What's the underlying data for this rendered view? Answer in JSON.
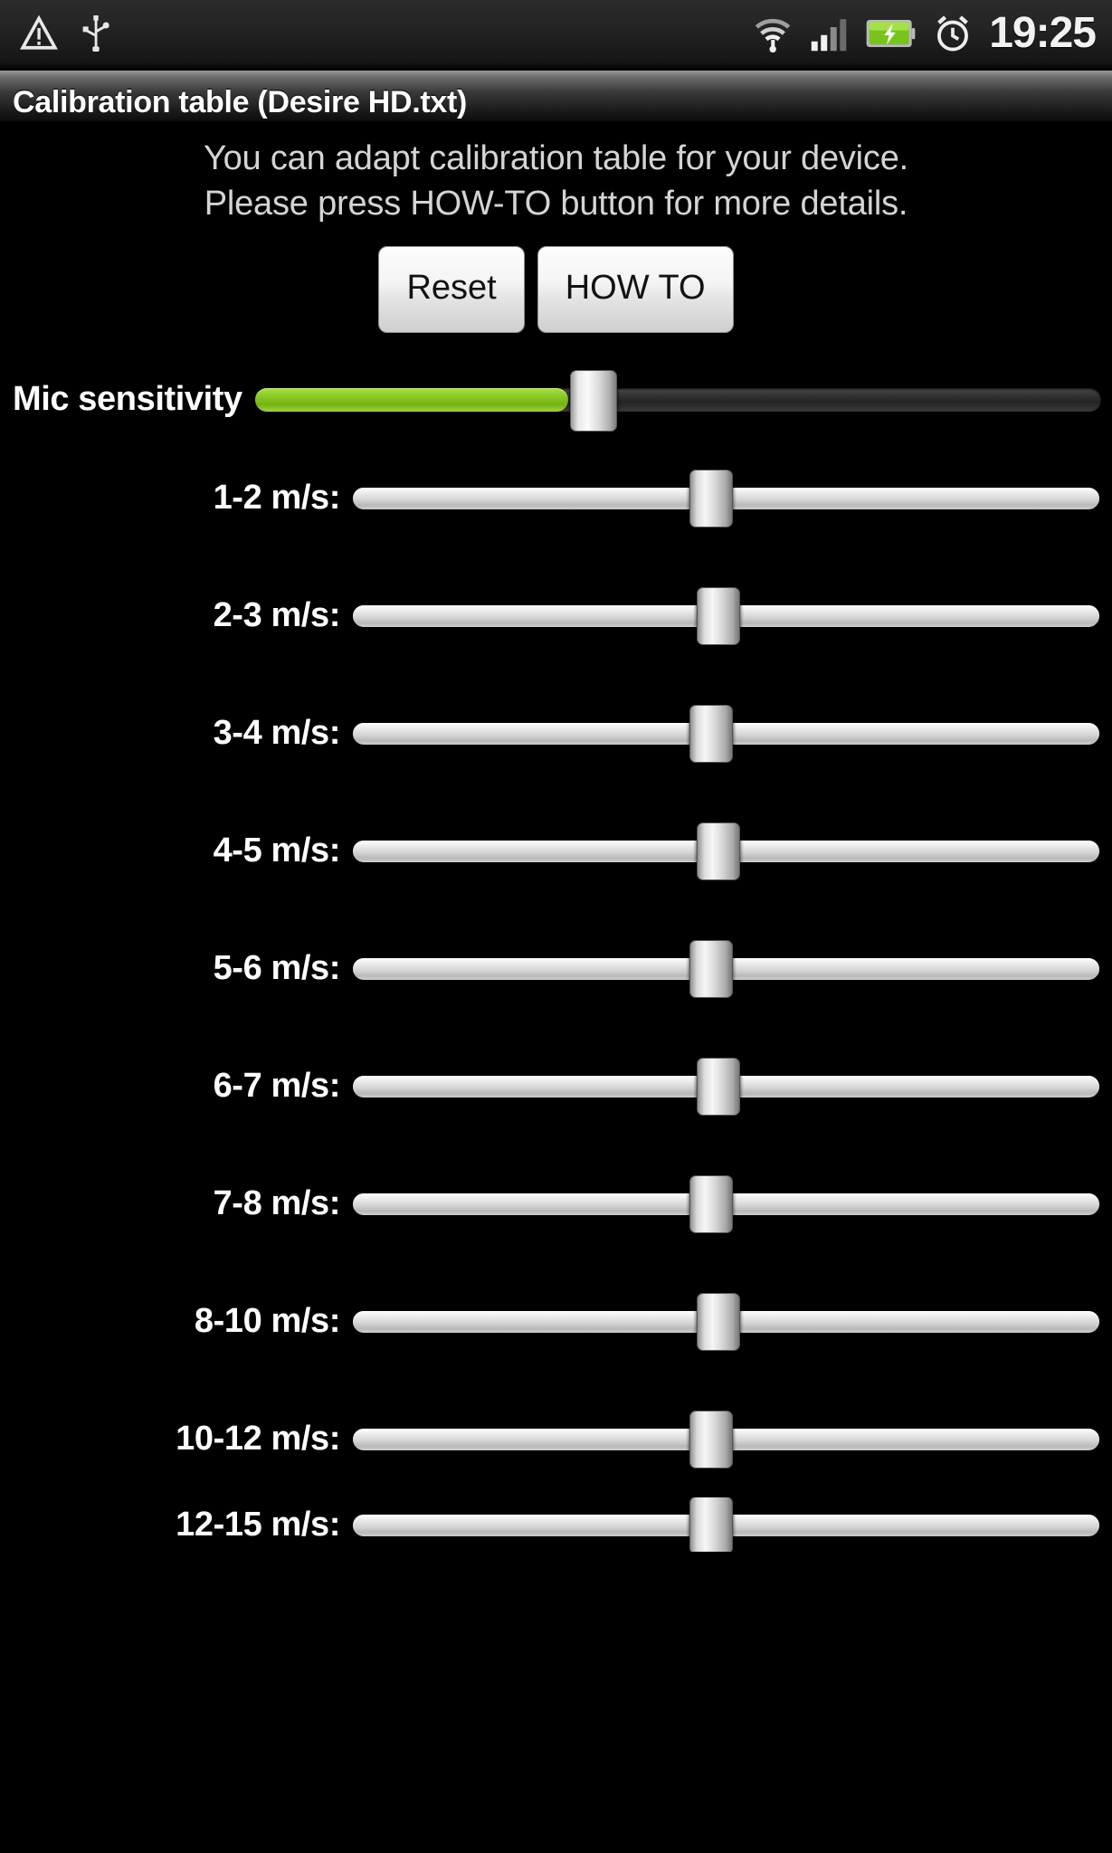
{
  "statusbar": {
    "icons_left": [
      "warning-triangle-icon",
      "usb-icon"
    ],
    "icons_right": [
      "wifi-icon",
      "signal-bars-icon",
      "battery-charging-icon",
      "alarm-clock-icon"
    ],
    "clock": "19:25"
  },
  "titlebar": {
    "title": "Calibration table (Desire HD.txt)"
  },
  "description": {
    "line1": "You can adapt calibration table for your device.",
    "line2": "Please press HOW-TO button for more details."
  },
  "buttons": {
    "reset_label": "Reset",
    "howto_label": "HOW TO"
  },
  "mic": {
    "label": "Mic sensitivity",
    "fill_percent": 37,
    "thumb_percent": 40
  },
  "colors": {
    "accent_green": "#8cc928",
    "background": "#000000",
    "title_bar": "#3a3a3a",
    "text_primary": "#ffffff",
    "text_secondary": "#d4d4d4"
  },
  "sliders": [
    {
      "label": "1-2 m/s:",
      "value_percent": 48
    },
    {
      "label": "2-3 m/s:",
      "value_percent": 49
    },
    {
      "label": "3-4 m/s:",
      "value_percent": 48
    },
    {
      "label": "4-5 m/s:",
      "value_percent": 49
    },
    {
      "label": "5-6 m/s:",
      "value_percent": 48
    },
    {
      "label": "6-7 m/s:",
      "value_percent": 49
    },
    {
      "label": "7-8 m/s:",
      "value_percent": 48
    },
    {
      "label": "8-10 m/s:",
      "value_percent": 49
    },
    {
      "label": "10-12 m/s:",
      "value_percent": 48
    },
    {
      "label": "12-15 m/s:",
      "value_percent": 48
    }
  ]
}
